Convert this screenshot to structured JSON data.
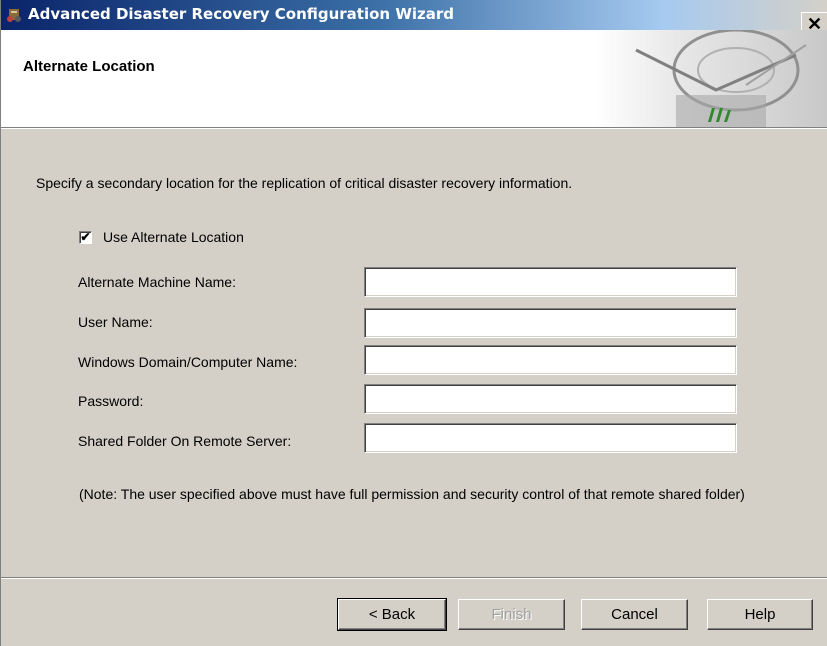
{
  "window": {
    "title": "Advanced Disaster Recovery Configuration Wizard",
    "close_glyph": "✕",
    "icon": "app-wizard-icon"
  },
  "header": {
    "title": "Alternate Location",
    "art": "wizard-header-art"
  },
  "body": {
    "description": "Specify a secondary location for the replication of critical disaster recovery information.",
    "use_alternate": {
      "label": "Use Alternate Location",
      "checked": true,
      "mark": "✔"
    },
    "fields": [
      {
        "label": "Alternate Machine Name:",
        "value": ""
      },
      {
        "label": "User Name:",
        "value": ""
      },
      {
        "label": "Windows Domain/Computer Name:",
        "value": ""
      },
      {
        "label": "Password:",
        "value": ""
      },
      {
        "label": "Shared Folder On Remote Server:",
        "value": ""
      }
    ],
    "note": "(Note: The user specified above must have full permission and security control of that remote shared folder)"
  },
  "buttons": {
    "back": "< Back",
    "finish": "Finish",
    "cancel": "Cancel",
    "help": "Help"
  },
  "colors": {
    "title_bar_start": "#0a246a",
    "dialog_face": "#d4d0c8"
  }
}
